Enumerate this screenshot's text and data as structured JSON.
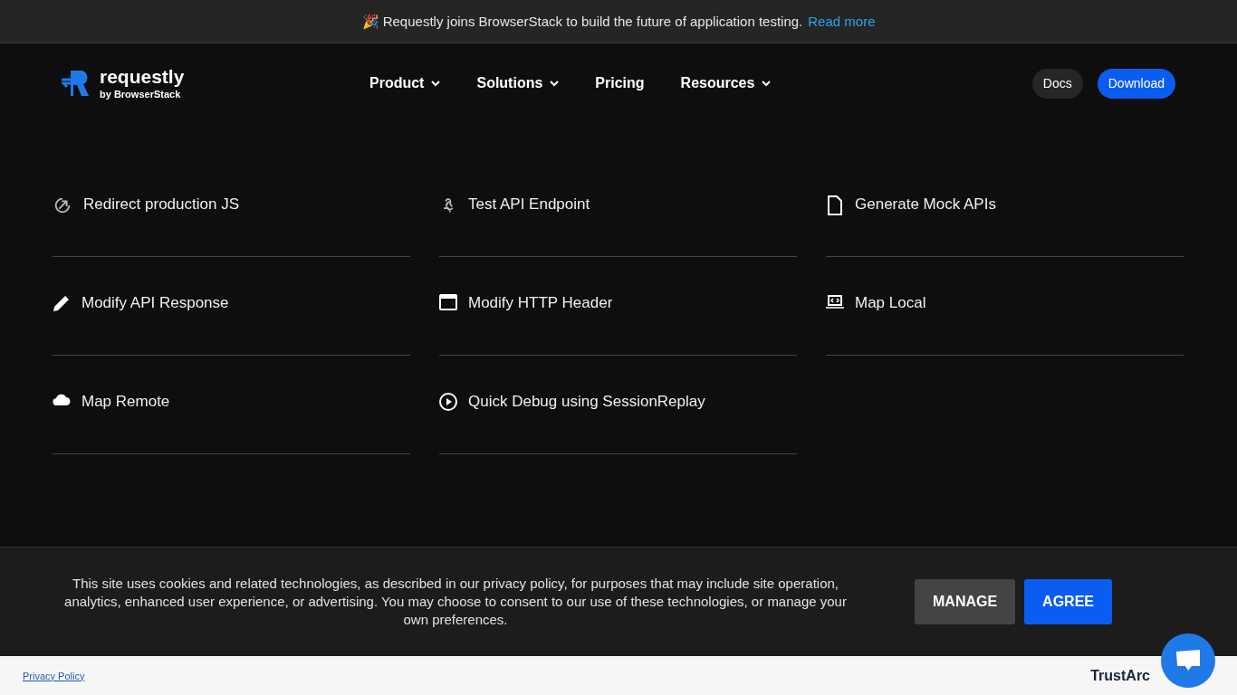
{
  "announcement": {
    "emoji": "🎉",
    "text": "Requestly joins BrowserStack to build the future of application testing.",
    "link": "Read more"
  },
  "nav": {
    "logo": {
      "name": "requestly",
      "tagline": "by BrowserStack"
    },
    "items": [
      {
        "label": "Product",
        "has_menu": true
      },
      {
        "label": "Solutions",
        "has_menu": true
      },
      {
        "label": "Pricing",
        "has_menu": false
      },
      {
        "label": "Resources",
        "has_menu": true
      }
    ],
    "buttons": [
      {
        "label": "Docs",
        "kind": "secondary"
      },
      {
        "label": "Download",
        "kind": "primary"
      }
    ]
  },
  "features": [
    {
      "label": "Redirect production JS",
      "kind": "redirect"
    },
    {
      "label": "Test API Endpoint",
      "kind": "webhook"
    },
    {
      "label": "Generate Mock APIs",
      "kind": "file"
    },
    {
      "label": "Modify API Response",
      "kind": "pencil"
    },
    {
      "label": "Modify HTTP Header",
      "kind": "window"
    },
    {
      "label": "Map Local",
      "kind": "laptop"
    },
    {
      "label": "Map Remote",
      "kind": "cloud"
    },
    {
      "label": "Quick Debug using SessionReplay",
      "kind": "play"
    }
  ],
  "cookie_banner": {
    "text": "This site uses cookies and related technologies, as described in our privacy policy, for purposes that may include site operation, analytics, enhanced user experience, or advertising. You may choose to consent to our use of these technologies, or manage your own preferences.",
    "buttons": [
      {
        "label": "MANAGE",
        "kind": "secondary"
      },
      {
        "label": "AGREE",
        "kind": "primary"
      }
    ]
  },
  "footer": {
    "link": "Privacy Policy",
    "brand": "TrustArc"
  }
}
